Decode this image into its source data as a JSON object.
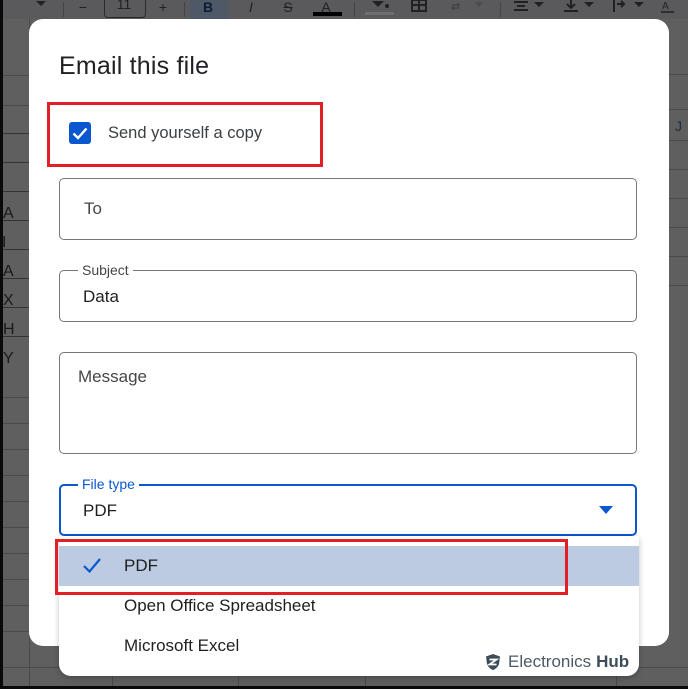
{
  "toolbar": {
    "minus": "−",
    "font_size": "11",
    "plus": "+",
    "bold": "B",
    "italic": "I",
    "strike": "S",
    "text_color": "A"
  },
  "sheet": {
    "row_letters": [
      "A",
      "I",
      "A",
      "X",
      "H",
      "Y"
    ],
    "column_letter": "J"
  },
  "dialog": {
    "title": "Email this file",
    "send_copy": {
      "label": "Send yourself a copy",
      "checked": true
    },
    "to": {
      "placeholder": "To",
      "value": ""
    },
    "subject": {
      "label": "Subject",
      "value": "Data"
    },
    "message": {
      "placeholder": "Message",
      "value": ""
    },
    "file_type": {
      "label": "File type",
      "value": "PDF",
      "options": [
        {
          "label": "PDF",
          "selected": true
        },
        {
          "label": "Open Office Spreadsheet",
          "selected": false
        },
        {
          "label": "Microsoft Excel",
          "selected": false
        }
      ]
    }
  },
  "watermark": {
    "brand": "Electronics",
    "brand_bold": "Hub"
  },
  "colors": {
    "accent": "#0b57d0",
    "highlight": "#e21f26",
    "selected_option_bg": "#bccbe2"
  }
}
